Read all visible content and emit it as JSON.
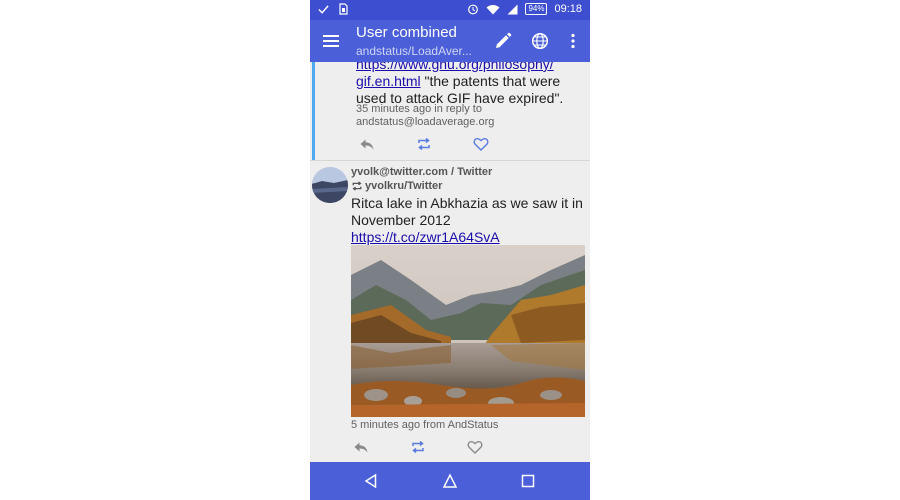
{
  "status_bar": {
    "battery": "94%",
    "time": "09:18"
  },
  "app_bar": {
    "title": "User combined",
    "subtitle": "andstatus/LoadAver..."
  },
  "message1": {
    "link_text_top": "https://www.gnu.org/philosophy/",
    "link_text": "gif.en.html",
    "text": " \"the patents that were used to attack GIF have expired\".",
    "meta_line1": "35 minutes ago in reply to",
    "meta_line2": "andstatus@loadaverage.org"
  },
  "message2": {
    "author": "yvolk@twitter.com / Twitter",
    "reblogged_by": "yvolkru/Twitter",
    "text": "Ritca lake in Abkhazia as we saw it in November 2012 ",
    "link_text": "https://t.co/zwr1A64SvA",
    "meta": "5 minutes ago from AndStatus"
  },
  "colors": {
    "status_bar": "#3d4fd0",
    "app_bar": "#4a5fd8",
    "selection_bar": "#4fa9ee",
    "action_active": "#5c7be0",
    "action_inactive": "#8a8a8a"
  },
  "icons": [
    "check-icon",
    "sim-icon",
    "alarm-icon",
    "wifi-icon",
    "signal-icon",
    "battery-icon",
    "menu-icon",
    "edit-icon",
    "globe-icon",
    "overflow-menu-icon",
    "reply-icon",
    "reblog-icon",
    "like-icon",
    "back-icon",
    "home-icon",
    "recents-icon"
  ]
}
